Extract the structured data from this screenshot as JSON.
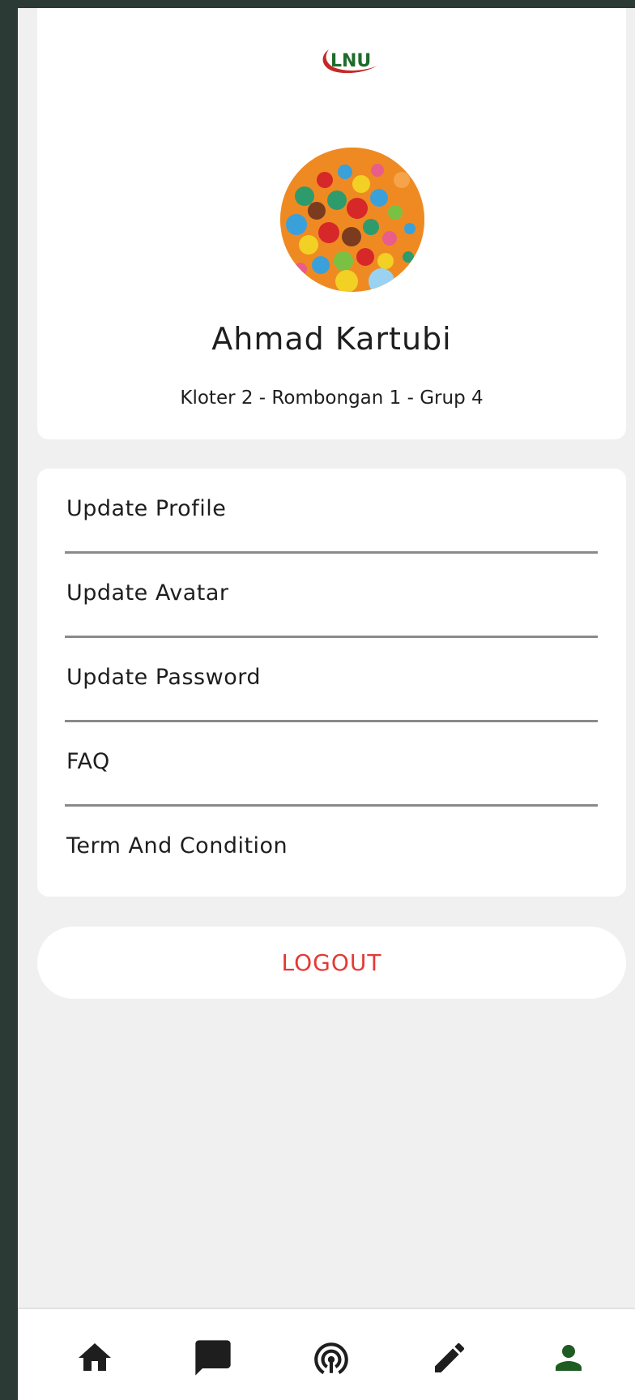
{
  "brand": {
    "logo_text": "LNU",
    "logo_text_color": "#1e6b2a",
    "logo_swoosh_color": "#c62828"
  },
  "profile": {
    "name": "Ahmad Kartubi",
    "group": "Kloter 2 - Rombongan 1 - Grup 4",
    "avatar_icon": "avatar-colorful-balls-image"
  },
  "menu": {
    "items": [
      {
        "label": "Update Profile"
      },
      {
        "label": "Update Avatar"
      },
      {
        "label": "Update Password"
      },
      {
        "label": "FAQ"
      },
      {
        "label": "Term And Condition"
      }
    ]
  },
  "logout": {
    "label": "LOGOUT",
    "color": "#e53935"
  },
  "bottom_nav": {
    "items": [
      {
        "icon": "home-icon",
        "active": false
      },
      {
        "icon": "chat-icon",
        "active": false
      },
      {
        "icon": "broadcast-icon",
        "active": false
      },
      {
        "icon": "edit-icon",
        "active": false
      },
      {
        "icon": "person-icon",
        "active": true
      }
    ],
    "icon_color": "#1e1e1e",
    "active_color": "#1e5c22"
  }
}
